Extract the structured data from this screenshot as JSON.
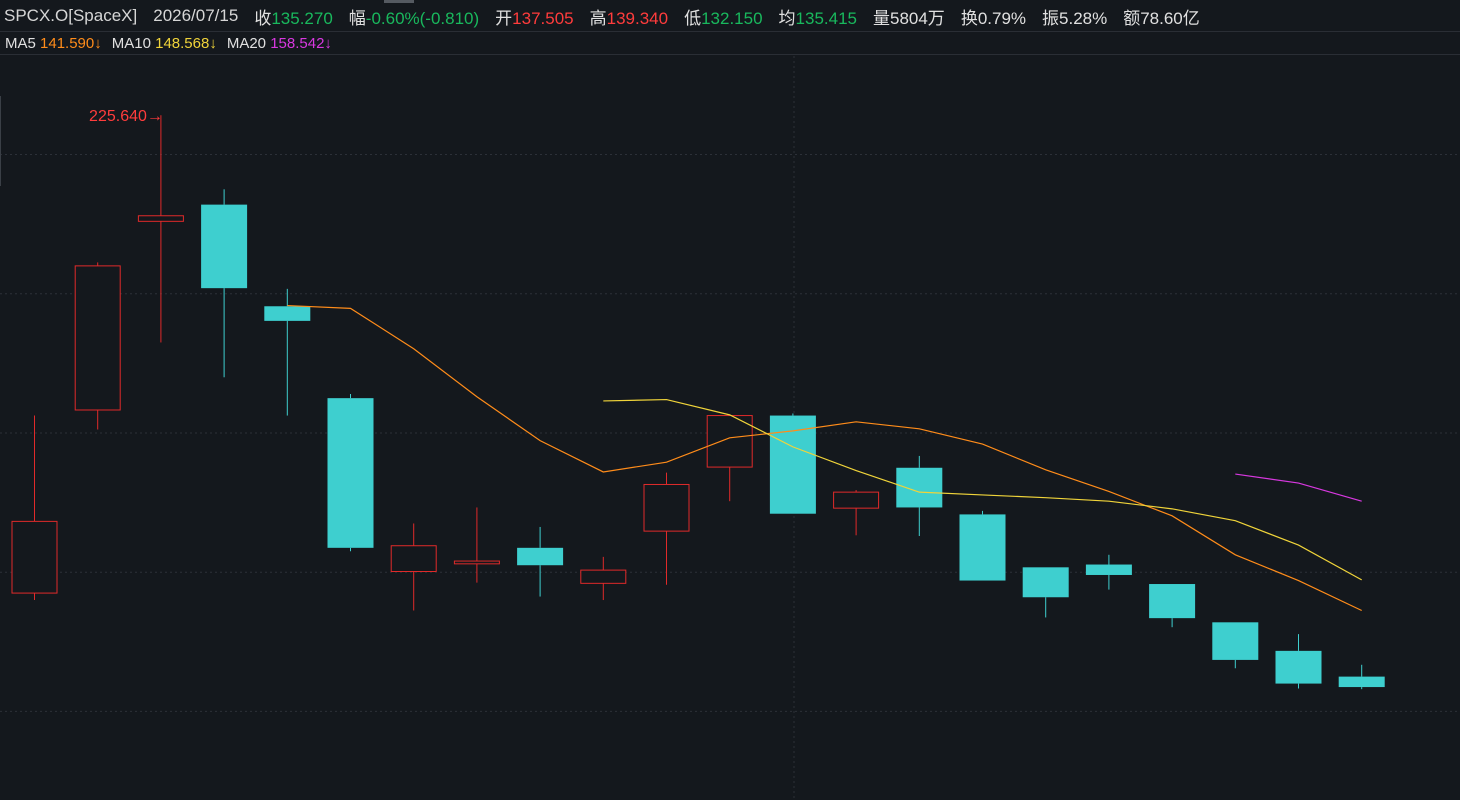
{
  "header": {
    "symbol": "SPCX.O[SpaceX]",
    "date": "2026/07/15",
    "fields": [
      {
        "label": "收",
        "value": "135.270",
        "tone": "down"
      },
      {
        "label": "幅",
        "value": "-0.60%(-0.810)",
        "tone": "down"
      },
      {
        "label": "开",
        "value": "137.505",
        "tone": "up"
      },
      {
        "label": "高",
        "value": "139.340",
        "tone": "up"
      },
      {
        "label": "低",
        "value": "132.150",
        "tone": "down"
      },
      {
        "label": "均",
        "value": "135.415",
        "tone": "down"
      },
      {
        "label": "量",
        "value": "5804万",
        "tone": "neutral"
      },
      {
        "label": "换",
        "value": "0.79%",
        "tone": "neutral"
      },
      {
        "label": "振",
        "value": "5.28%",
        "tone": "neutral"
      },
      {
        "label": "额",
        "value": "78.60亿",
        "tone": "neutral"
      }
    ]
  },
  "ma_bar": [
    {
      "label": "MA5",
      "value": "141.590↓",
      "color": "#ff8c1a"
    },
    {
      "label": "MA10",
      "value": "148.568↓",
      "color": "#f0d43a"
    },
    {
      "label": "MA20",
      "value": "158.542↓",
      "color": "#d838e0"
    }
  ],
  "colors": {
    "background": "#14181d",
    "up": "#e02a2a",
    "down": "#3ecfcf",
    "grid": "#2c3038",
    "ma5": "#ff8c1a",
    "ma10": "#f0d43a",
    "ma20": "#d838e0",
    "peak_label": "#ff3c3c"
  },
  "chart_data": {
    "type": "candlestick",
    "ylim": [
      129,
      233
    ],
    "peak_label": "225.640→",
    "peak_value": 225.64,
    "candles": [
      {
        "o": 157.0,
        "h": 182.5,
        "l": 156.0,
        "c": 167.3
      },
      {
        "o": 183.3,
        "h": 204.5,
        "l": 180.5,
        "c": 204.0
      },
      {
        "o": 210.4,
        "h": 225.64,
        "l": 193.0,
        "c": 211.2
      },
      {
        "o": 212.8,
        "h": 215.0,
        "l": 188.0,
        "c": 200.8
      },
      {
        "o": 198.2,
        "h": 200.7,
        "l": 182.5,
        "c": 196.1
      },
      {
        "o": 185.0,
        "h": 185.6,
        "l": 163.0,
        "c": 163.5
      },
      {
        "o": 160.1,
        "h": 167.0,
        "l": 154.5,
        "c": 163.8
      },
      {
        "o": 161.2,
        "h": 169.3,
        "l": 158.5,
        "c": 161.6
      },
      {
        "o": 163.5,
        "h": 166.5,
        "l": 156.5,
        "c": 161.0
      },
      {
        "o": 158.4,
        "h": 162.2,
        "l": 156.0,
        "c": 160.3
      },
      {
        "o": 165.9,
        "h": 174.3,
        "l": 158.2,
        "c": 172.6
      },
      {
        "o": 175.1,
        "h": 177.7,
        "l": 170.2,
        "c": 182.5
      },
      {
        "o": 182.5,
        "h": 182.8,
        "l": 168.4,
        "c": 168.4
      },
      {
        "o": 169.2,
        "h": 171.8,
        "l": 165.3,
        "c": 171.5
      },
      {
        "o": 175.0,
        "h": 176.7,
        "l": 165.2,
        "c": 169.3
      },
      {
        "o": 168.3,
        "h": 168.8,
        "l": 158.8,
        "c": 158.8
      },
      {
        "o": 160.7,
        "h": 160.7,
        "l": 153.5,
        "c": 156.4
      },
      {
        "o": 161.1,
        "h": 162.5,
        "l": 157.5,
        "c": 159.6
      },
      {
        "o": 158.3,
        "h": 158.3,
        "l": 152.1,
        "c": 153.4
      },
      {
        "o": 152.8,
        "h": 152.8,
        "l": 146.2,
        "c": 147.4
      },
      {
        "o": 148.7,
        "h": 151.1,
        "l": 143.3,
        "c": 144.0
      },
      {
        "o": 145.0,
        "h": 146.7,
        "l": 143.2,
        "c": 143.5
      }
    ],
    "ma5": [
      null,
      null,
      null,
      null,
      198.3,
      197.9,
      192.1,
      185.2,
      178.9,
      174.4,
      175.8,
      179.3,
      180.3,
      181.6,
      180.6,
      178.4,
      174.7,
      171.6,
      168.1,
      162.5,
      158.8,
      154.5
    ],
    "ma10": [
      null,
      null,
      null,
      null,
      null,
      null,
      null,
      null,
      null,
      184.6,
      184.8,
      182.6,
      178.0,
      174.6,
      171.5,
      171.1,
      170.7,
      170.2,
      169.1,
      167.4,
      163.9,
      158.9
    ],
    "ma20": [
      null,
      null,
      null,
      null,
      null,
      null,
      null,
      null,
      null,
      null,
      null,
      null,
      null,
      null,
      null,
      null,
      null,
      null,
      null,
      174.1,
      172.8,
      170.2
    ]
  }
}
